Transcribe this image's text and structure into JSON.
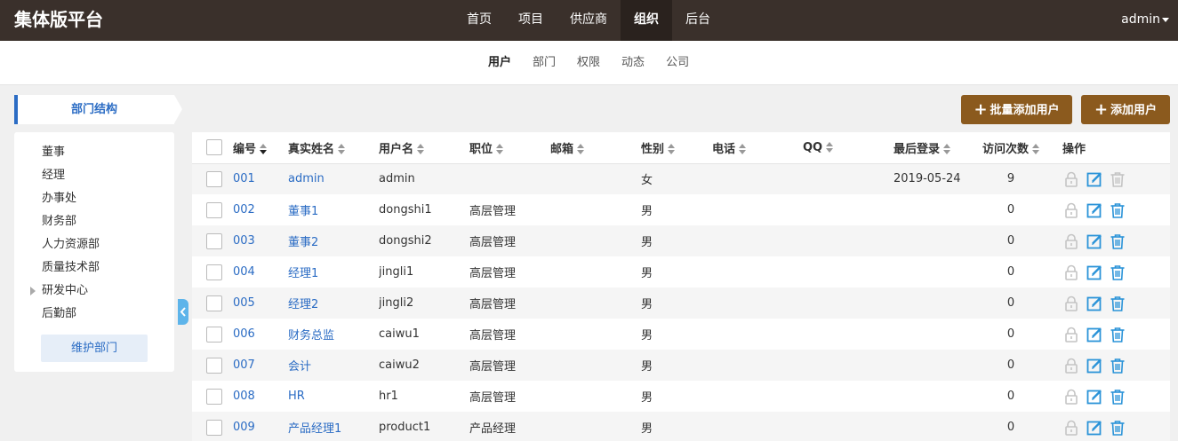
{
  "header": {
    "brand": "集体版平台",
    "nav": [
      {
        "label": "首页",
        "active": false
      },
      {
        "label": "项目",
        "active": false
      },
      {
        "label": "供应商",
        "active": false
      },
      {
        "label": "组织",
        "active": true
      },
      {
        "label": "后台",
        "active": false
      }
    ],
    "user": "admin"
  },
  "subnav": [
    {
      "label": "用户",
      "active": true
    },
    {
      "label": "部门",
      "active": false
    },
    {
      "label": "权限",
      "active": false
    },
    {
      "label": "动态",
      "active": false
    },
    {
      "label": "公司",
      "active": false
    }
  ],
  "sidebar": {
    "title": "部门结构",
    "departments": [
      {
        "label": "董事",
        "expandable": false
      },
      {
        "label": "经理",
        "expandable": false
      },
      {
        "label": "办事处",
        "expandable": false
      },
      {
        "label": "财务部",
        "expandable": false
      },
      {
        "label": "人力资源部",
        "expandable": false
      },
      {
        "label": "质量技术部",
        "expandable": false
      },
      {
        "label": "研发中心",
        "expandable": true
      },
      {
        "label": "后勤部",
        "expandable": false
      }
    ],
    "maintain_button": "维护部门"
  },
  "toolbar": {
    "batch_add": "批量添加用户",
    "add": "添加用户"
  },
  "table": {
    "headers": {
      "id": "编号",
      "realname": "真实姓名",
      "username": "用户名",
      "position": "职位",
      "email": "邮箱",
      "gender": "性别",
      "phone": "电话",
      "qq": "QQ",
      "last_login": "最后登录",
      "visits": "访问次数",
      "actions": "操作"
    },
    "rows": [
      {
        "id": "001",
        "realname": "admin",
        "username": "admin",
        "position": "",
        "email": "",
        "gender": "女",
        "phone": "",
        "qq": "",
        "last_login": "2019-05-24",
        "visits": "9",
        "deletable": false
      },
      {
        "id": "002",
        "realname": "董事1",
        "username": "dongshi1",
        "position": "高层管理",
        "email": "",
        "gender": "男",
        "phone": "",
        "qq": "",
        "last_login": "",
        "visits": "0",
        "deletable": true
      },
      {
        "id": "003",
        "realname": "董事2",
        "username": "dongshi2",
        "position": "高层管理",
        "email": "",
        "gender": "男",
        "phone": "",
        "qq": "",
        "last_login": "",
        "visits": "0",
        "deletable": true
      },
      {
        "id": "004",
        "realname": "经理1",
        "username": "jingli1",
        "position": "高层管理",
        "email": "",
        "gender": "男",
        "phone": "",
        "qq": "",
        "last_login": "",
        "visits": "0",
        "deletable": true
      },
      {
        "id": "005",
        "realname": "经理2",
        "username": "jingli2",
        "position": "高层管理",
        "email": "",
        "gender": "男",
        "phone": "",
        "qq": "",
        "last_login": "",
        "visits": "0",
        "deletable": true
      },
      {
        "id": "006",
        "realname": "财务总监",
        "username": "caiwu1",
        "position": "高层管理",
        "email": "",
        "gender": "男",
        "phone": "",
        "qq": "",
        "last_login": "",
        "visits": "0",
        "deletable": true
      },
      {
        "id": "007",
        "realname": "会计",
        "username": "caiwu2",
        "position": "高层管理",
        "email": "",
        "gender": "男",
        "phone": "",
        "qq": "",
        "last_login": "",
        "visits": "0",
        "deletable": true
      },
      {
        "id": "008",
        "realname": "HR",
        "username": "hr1",
        "position": "高层管理",
        "email": "",
        "gender": "男",
        "phone": "",
        "qq": "",
        "last_login": "",
        "visits": "0",
        "deletable": true
      },
      {
        "id": "009",
        "realname": "产品经理1",
        "username": "product1",
        "position": "产品经理",
        "email": "",
        "gender": "男",
        "phone": "",
        "qq": "",
        "last_login": "",
        "visits": "0",
        "deletable": true
      }
    ]
  },
  "icons": {
    "lock": "lock-icon",
    "edit": "edit-icon",
    "delete": "trash-icon"
  },
  "colors": {
    "header_bg": "#3a302b",
    "accent_blue": "#2b6cc4",
    "button_brown": "#8b5a1e",
    "icon_blue": "#2a93d8",
    "icon_gray": "#c4c4c4"
  }
}
